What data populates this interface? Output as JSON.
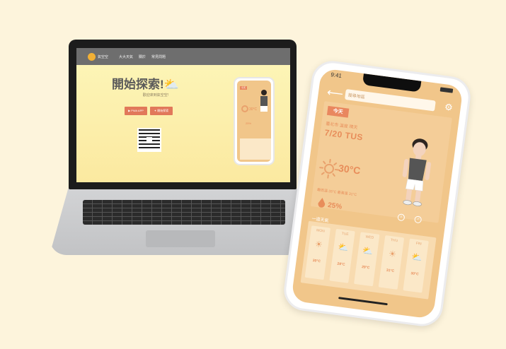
{
  "laptop": {
    "nav": {
      "brand": "氣空空",
      "items": [
        "大大天氣",
        "關於",
        "常見問題"
      ]
    },
    "hero_title": "開始探索!",
    "hero_subtitle": "歡迎來到氣空空!",
    "buttons": [
      "▶ PWA APP",
      "✦ 開始探索"
    ],
    "mini_phone": {
      "today": "今天",
      "temp": "30°C",
      "rain": "25%"
    }
  },
  "phone": {
    "status_time": "9:41",
    "search_placeholder": "搜尋地區",
    "today_badge": "今天",
    "location": "臺北市 溫度 晴天",
    "date": "7/20 TUS",
    "temperature": "30°C",
    "temp_range": "最低溫 26°C 最高溫 31°C",
    "rain_chance": "25%",
    "week_label": "一週天氣",
    "week": [
      {
        "day": "MON",
        "icon": "☀",
        "temp": "30°C"
      },
      {
        "day": "TUE",
        "icon": "⛅",
        "temp": "28°C"
      },
      {
        "day": "WED",
        "icon": "⛅",
        "temp": "29°C"
      },
      {
        "day": "THU",
        "icon": "☀",
        "temp": "31°C"
      },
      {
        "day": "FRI",
        "icon": "⛅",
        "temp": "30°C"
      }
    ]
  },
  "colors": {
    "phone_bg": "#f1c68a",
    "accent": "#e88d5a",
    "laptop_bg": "#fdf6b9",
    "page_bg": "#fdf4dc"
  }
}
